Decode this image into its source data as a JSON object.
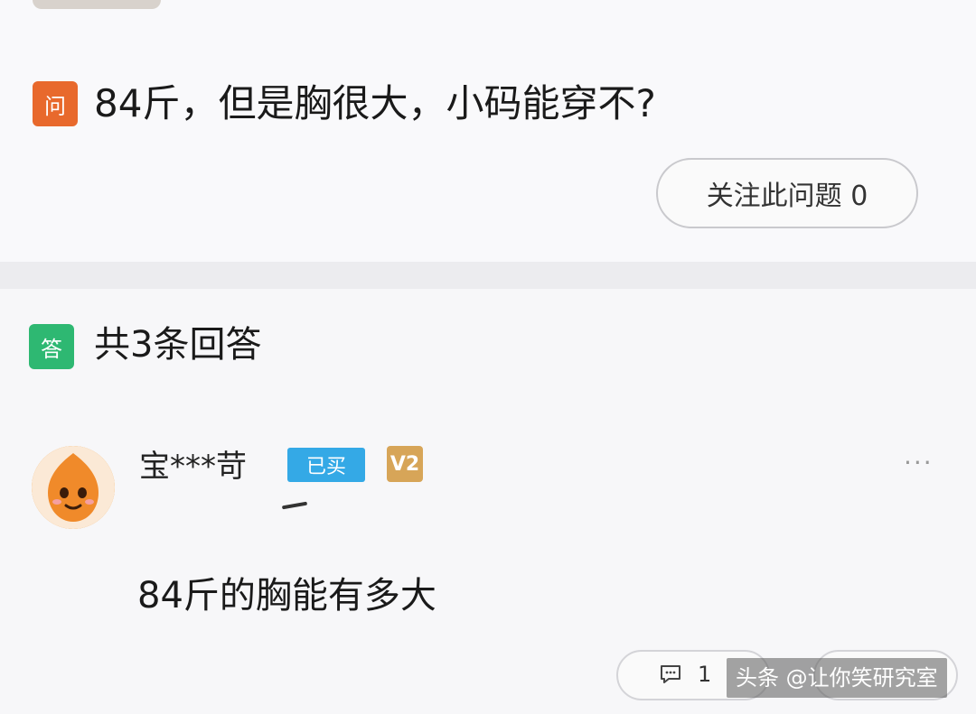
{
  "question": {
    "badge_label": "问",
    "text": "84斤，但是胸很大，小码能穿不?",
    "follow_button_label": "关注此问题 0"
  },
  "answers": {
    "badge_label": "答",
    "count_label": "共3条回答",
    "items": [
      {
        "username": "宝***苛",
        "bought_badge": "已买",
        "level_badge": "V2",
        "text": "84斤的胸能有多大",
        "comment_count": "1"
      }
    ]
  },
  "watermark": "头条 @让你笑研究室",
  "icons": {
    "more": "more-dots-icon",
    "comment": "comment-icon",
    "avatar": "cartoon-avatar"
  },
  "colors": {
    "question_badge": "#e8692c",
    "answer_badge": "#2eb872",
    "bought_badge": "#34a9e6",
    "level_badge": "#d7a558"
  }
}
